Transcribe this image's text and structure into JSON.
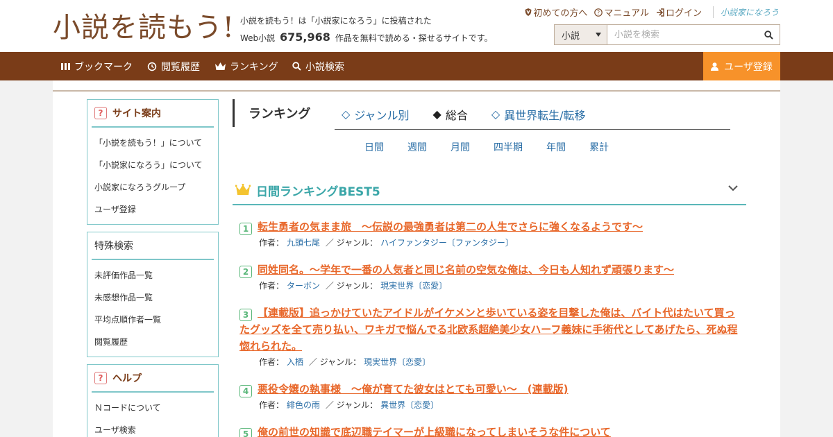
{
  "header": {
    "logo": "小説を読もう!",
    "tagline_line1": "小説を読もう！は「小説家になろう」に投稿された",
    "tagline_prefix": "Web小説",
    "novel_count": "675,968",
    "tagline_suffix": "作品を無料で読める・探せるサイトです。",
    "links": [
      "初めての方へ",
      "マニュアル",
      "ログイン"
    ],
    "sister_site": "小説家になろう",
    "search": {
      "select_value": "小説",
      "placeholder": "小説を検索"
    }
  },
  "nav": {
    "items": [
      "ブックマーク",
      "閲覧履歴",
      "ランキング",
      "小説検索"
    ],
    "register": "ユーザ登録"
  },
  "sidebar": {
    "site_guide": {
      "title": "サイト案内",
      "items": [
        "「小説を読もう！」について",
        "「小説家になろう」について",
        "小説家になろうグループ",
        "ユーザ登録"
      ]
    },
    "special_search": {
      "title": "特殊検索",
      "items": [
        "未評価作品一覧",
        "未感想作品一覧",
        "平均点順作者一覧",
        "閲覧履歴"
      ]
    },
    "help": {
      "title": "ヘルプ",
      "items": [
        "Ｎコードについて",
        "ユーザ検索"
      ]
    }
  },
  "main": {
    "ranking_title": "ランキング",
    "tabs": [
      {
        "label": "ジャンル別",
        "marker": "◇",
        "active": false
      },
      {
        "label": "総合",
        "marker": "◆",
        "active": true
      },
      {
        "label": "異世界転生/転移",
        "marker": "◇",
        "active": false
      }
    ],
    "periods": [
      "日間",
      "週間",
      "月間",
      "四半期",
      "年間",
      "累計"
    ],
    "best_title": "日間ランキングBEST5",
    "author_label": "作者：",
    "genre_label": "／ ジャンル：",
    "entries": [
      {
        "rank": "1",
        "title": "転生勇者の気まま旅　～伝説の最強勇者は第二の人生でさらに強くなるようです～",
        "author": "九頭七尾",
        "genre": "ハイファンタジー〔ファンタジー〕"
      },
      {
        "rank": "2",
        "title": "同姓同名。～学年で一番の人気者と同じ名前の空気な俺は、今日も人知れず頑張ります～",
        "author": "ターボン",
        "genre": "現実世界〔恋愛〕"
      },
      {
        "rank": "3",
        "title": "【連載版】追っかけていたアイドルがイケメンと歩いている姿を目撃した俺は、バイト代はたいて買ったグッズを全て売り払い、ワキガで悩んでる北欧系超絶美少女ハーフ義妹に手術代としてあげたら、死ぬ程惚れられた。",
        "author": "入栖",
        "genre": "現実世界〔恋愛〕"
      },
      {
        "rank": "4",
        "title": "悪役令嬢の執事様　～俺が育てた彼女はとても可愛い～　(連載版)",
        "author": "緋色の雨",
        "genre": "異世界〔恋愛〕"
      },
      {
        "rank": "5",
        "title": "俺の前世の知識で底辺職テイマーが上級職になってしまいそうな件について",
        "author": "",
        "genre": ""
      }
    ]
  },
  "colors": {
    "brand_brown": "#7a3c18",
    "accent_orange": "#f7922a",
    "teal": "#5ab7b9",
    "link_blue": "#2a6ea6",
    "title_orange": "#e8672a"
  }
}
